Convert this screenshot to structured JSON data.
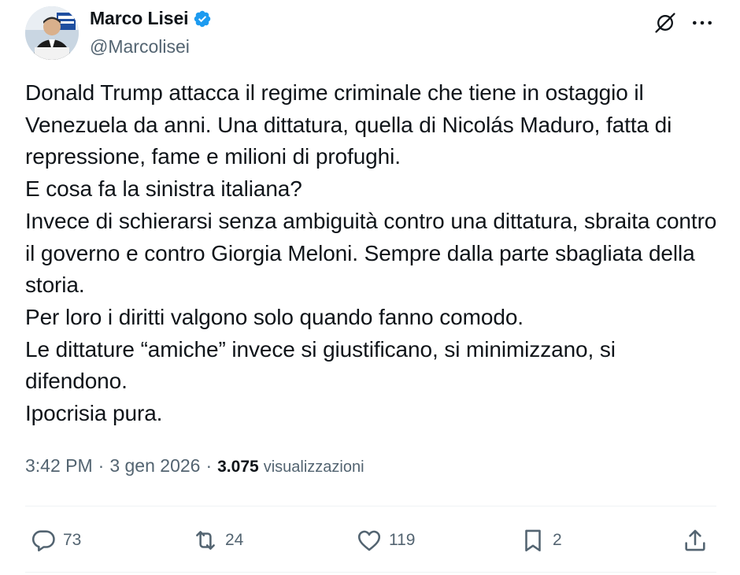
{
  "author": {
    "display_name": "Marco Lisei",
    "handle": "@Marcolisei",
    "verified_icon": "verified-badge-icon",
    "avatar": "avatar"
  },
  "header_icons": {
    "grok": "grok-icon",
    "more": "more-icon"
  },
  "tweet": {
    "lines": [
      "Donald Trump attacca il regime criminale che tiene in ostaggio il Venezuela da anni. Una dittatura, quella di Nicolás Maduro, fatta di repressione, fame e milioni di profughi.",
      "E cosa fa la sinistra italiana?",
      "Invece di schierarsi senza ambiguità contro una dittatura, sbraita contro il governo e contro Giorgia Meloni. Sempre dalla parte sbagliata della storia.",
      "Per loro i diritti valgono solo quando fanno comodo.",
      "Le dittature “amiche” invece si giustificano, si minimizzano, si difendono.",
      "Ipocrisia pura."
    ]
  },
  "meta": {
    "time": "3:42 PM",
    "separator": "·",
    "date": "3 gen 2026",
    "views_count": "3.075",
    "views_label": "visualizzazioni"
  },
  "actions": {
    "reply_count": "73",
    "retweet_count": "24",
    "like_count": "119",
    "bookmark_count": "2"
  },
  "colors": {
    "text": "#0f1419",
    "secondary": "#536471",
    "verified": "#1d9bf0",
    "divider": "#eff3f4"
  }
}
